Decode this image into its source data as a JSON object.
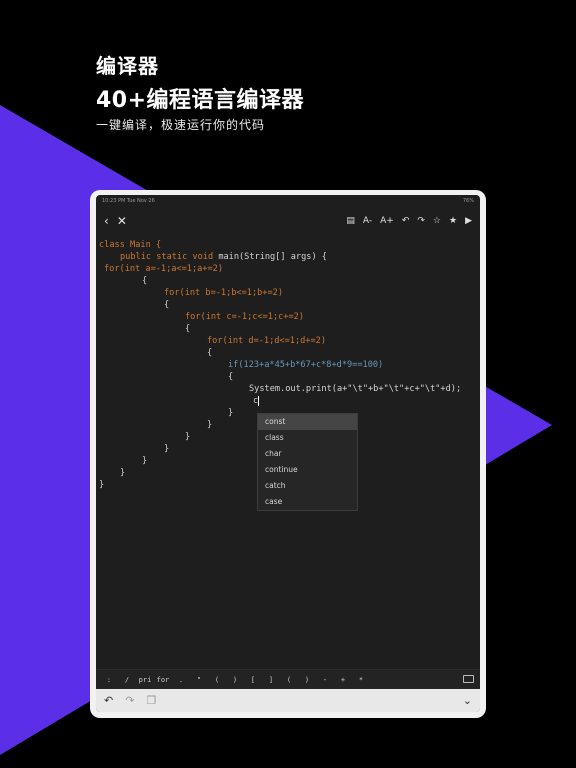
{
  "promo": {
    "title_small": "编译器",
    "title_big": "40+编程语言编译器",
    "subtitle": "一键编译，极速运行你的代码"
  },
  "colors": {
    "accent": "#5b2ee8",
    "editor_bg": "#1e1e1e",
    "keyword": "#cc7832",
    "number": "#6897bb",
    "string": "#6a8759"
  },
  "status": {
    "time": "10:23 PM  Tue Nov 26",
    "battery": "76%"
  },
  "toolbar": {
    "back_icon": "chevron-left-icon",
    "close_icon": "close-icon",
    "file_icon": "document-icon",
    "font_decrease": "A-",
    "font_increase": "A+",
    "undo_icon": "undo-icon",
    "redo_icon": "redo-icon",
    "star_outline_icon": "star-outline-icon",
    "star_filled_icon": "star-filled-icon",
    "run_icon": "play-icon"
  },
  "code": {
    "l1": "class Main {",
    "l2a": "public static void ",
    "l2b": "main(String[] args) {",
    "l3": "for(int a=-1;a<=1;a+=2)",
    "l4": "{",
    "l5": "for(int b=-1;b<=1;b+=2)",
    "l6": "{",
    "l7": "for(int c=-1;c<=1;c+=2)",
    "l8": "{",
    "l9": "for(int d=-1;d<=1;d+=2)",
    "l10": "{",
    "l11": "if(123+a*45+b*67+c*8+d*9==100)",
    "l12": "{",
    "l13": "System.out.print(a+\"\\t\"+b+\"\\t\"+c+\"\\t\"+d);",
    "l14": "c",
    "l15": "}",
    "l16": "}",
    "l17": "}",
    "l18": "}",
    "l19": "}",
    "l20": "}",
    "l21": "}"
  },
  "autocomplete": [
    "const",
    "class",
    "char",
    "continue",
    "catch",
    "case"
  ],
  "symbols": [
    ":",
    "/",
    "pri",
    "for",
    ".",
    "\"",
    "(",
    ")",
    "[",
    "]",
    "(",
    ")",
    "-",
    "+",
    "*"
  ],
  "bottombar": {
    "undo_icon": "undo-icon",
    "redo_icon": "redo-icon",
    "copy_icon": "copy-icon",
    "collapse_icon": "chevron-down-icon"
  }
}
